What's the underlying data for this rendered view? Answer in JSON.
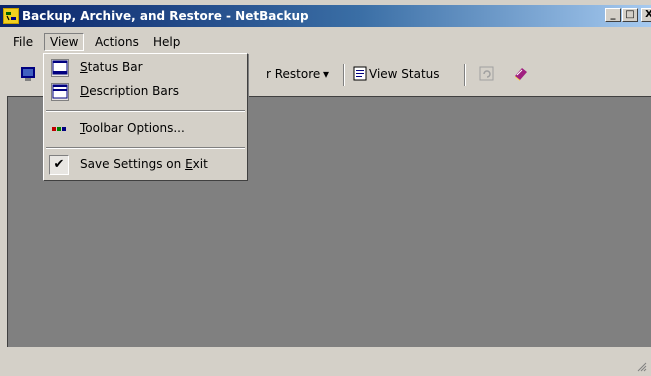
{
  "window": {
    "title": "Backup, Archive, and Restore - NetBackup",
    "controls": {
      "minimize": "_",
      "maximize": "□",
      "close": "X"
    }
  },
  "menubar": {
    "items": [
      {
        "label": "File"
      },
      {
        "label": "View"
      },
      {
        "label": "Actions"
      },
      {
        "label": "Help"
      }
    ]
  },
  "toolbar": {
    "restore_label": "r Restore",
    "restore_dropdown": "▾",
    "view_status_label": "View Status"
  },
  "view_menu": {
    "items": [
      {
        "label": "Status Bar",
        "mnemonic": "S",
        "rest": "tatus Bar"
      },
      {
        "label": "Description Bars",
        "mnemonic": "D",
        "rest": "escription Bars"
      },
      {
        "label": "Toolbar Options...",
        "mnemonic": "T",
        "rest": "oolbar Options..."
      },
      {
        "label": "Save Settings on Exit",
        "prefix": "Save Settings on ",
        "mnemonic": "E",
        "rest": "xit",
        "checked": true
      }
    ],
    "check_mark": "✔"
  },
  "colors": {
    "title_gradient_start": "#0a246a",
    "title_gradient_end": "#a6caf0",
    "client_background": "#808080",
    "chrome": "#d4d0c8"
  }
}
